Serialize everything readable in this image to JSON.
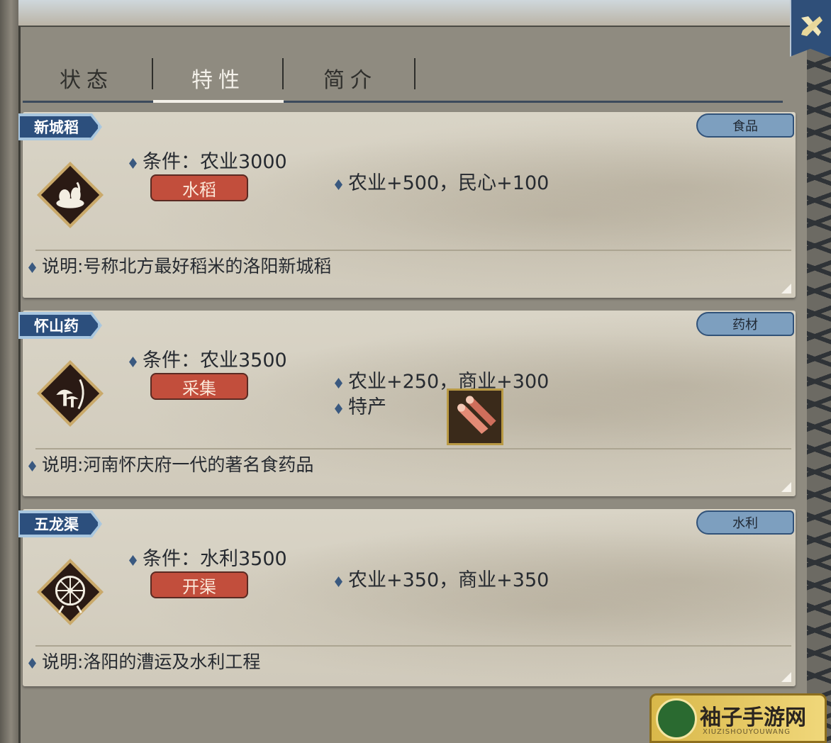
{
  "tabs": [
    {
      "label": "状态",
      "active": false
    },
    {
      "label": "特性",
      "active": true
    },
    {
      "label": "简介",
      "active": false
    }
  ],
  "items": [
    {
      "name": "新城稻",
      "type": "食品",
      "condition": "条件：农业3000",
      "requirement": "水稻",
      "effects": [
        "农业+500，民心+100"
      ],
      "description": "说明:号称北方最好稻米的洛阳新城稻",
      "icon": "rice-bowl-icon"
    },
    {
      "name": "怀山药",
      "type": "药材",
      "condition": "条件：农业3500",
      "requirement": "采集",
      "effects": [
        "农业+250，商业+300",
        "特产"
      ],
      "description": "说明:河南怀庆府一代的著名食药品",
      "icon": "mushroom-herb-icon",
      "specialty_icon": "yam-specialty-icon"
    },
    {
      "name": "五龙渠",
      "type": "水利",
      "condition": "条件：水利3500",
      "requirement": "开渠",
      "effects": [
        "农业+350，商业+350"
      ],
      "description": "说明:洛阳的漕运及水利工程",
      "icon": "waterwheel-icon"
    }
  ],
  "watermark": {
    "title": "袖子手游网",
    "subtitle": "XIUZISHOUYOUWANG"
  },
  "colors": {
    "accent_blue": "#2c4f7d",
    "button_red": "#c24e3c",
    "card_bg": "#d5cfc1"
  }
}
